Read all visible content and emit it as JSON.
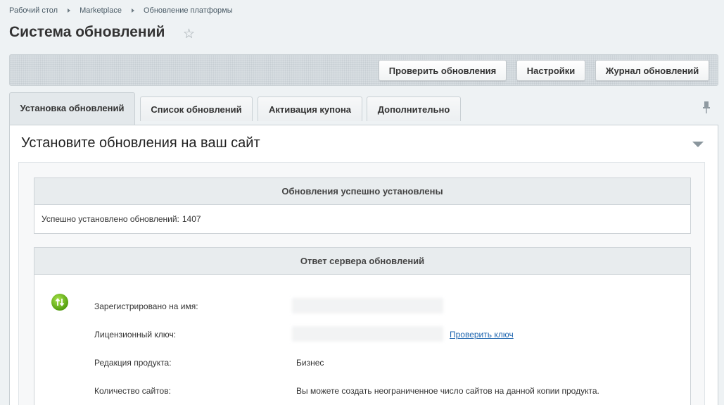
{
  "breadcrumb": [
    "Рабочий стол",
    "Marketplace",
    "Обновление платформы"
  ],
  "page_title": "Система обновлений",
  "toolbar": {
    "check_updates": "Проверить обновления",
    "settings": "Настройки",
    "log": "Журнал обновлений"
  },
  "tabs": [
    {
      "label": "Установка обновлений",
      "active": true
    },
    {
      "label": "Список обновлений",
      "active": false
    },
    {
      "label": "Активация купона",
      "active": false
    },
    {
      "label": "Дополнительно",
      "active": false
    }
  ],
  "panel": {
    "heading": "Установите обновления на ваш сайт",
    "success_box": {
      "title": "Обновления успешно установлены",
      "text": "Успешно установлено обновлений:",
      "count": "1407"
    },
    "server_box": {
      "title": "Ответ сервера обновлений",
      "rows": [
        {
          "label": "Зарегистрировано на имя:",
          "value": ""
        },
        {
          "label": "Лицензионный ключ:",
          "value": "",
          "link": "Проверить ключ"
        },
        {
          "label": "Редакция продукта:",
          "value": "Бизнес"
        },
        {
          "label": "Количество сайтов:",
          "value": "Вы можете создать неограниченное число сайтов на данной копии продукта."
        }
      ]
    }
  },
  "colors": {
    "accent_link": "#2067b0",
    "page_bg": "#eef2f4",
    "status_icon": "#55a010"
  }
}
